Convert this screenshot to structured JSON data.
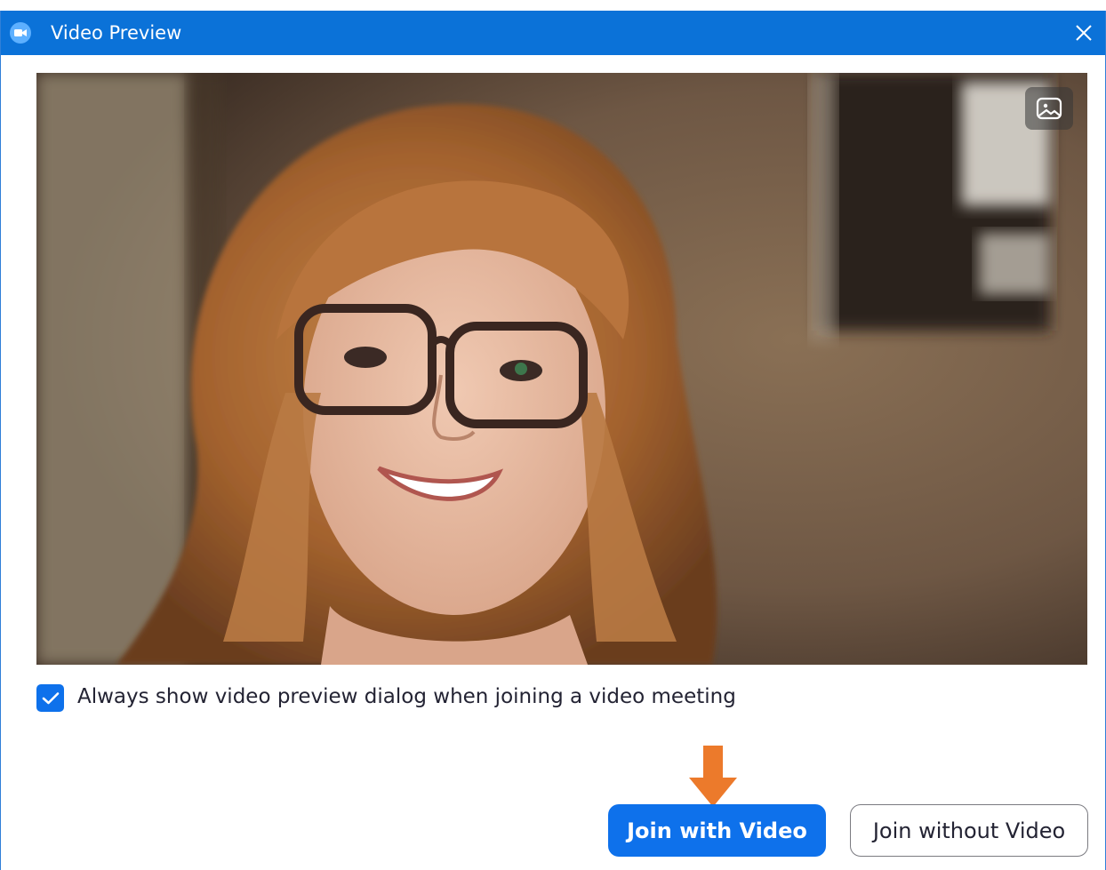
{
  "window": {
    "title": "Video Preview",
    "icons": {
      "app": "camera-icon",
      "close": "close-icon"
    }
  },
  "video": {
    "background_button_icon": "image-icon"
  },
  "preferences": {
    "always_show_checked": true,
    "always_show_label": "Always show video preview dialog when joining a video meeting"
  },
  "actions": {
    "join_with_video_label": "Join with Video",
    "join_without_video_label": "Join without Video"
  },
  "colors": {
    "titlebar": "#0b72d8",
    "accent": "#0e71eb",
    "annotation_arrow": "#ec7a2b"
  }
}
